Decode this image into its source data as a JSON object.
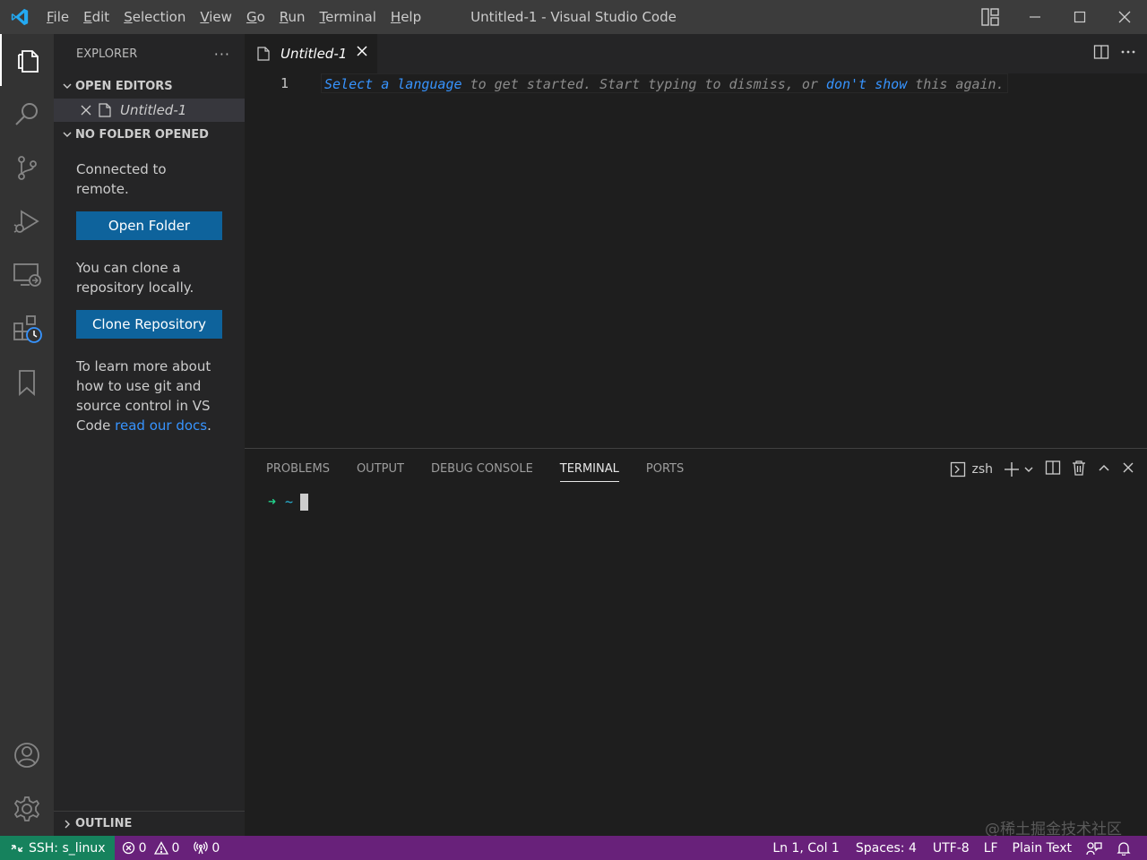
{
  "window": {
    "title": "Untitled-1 - Visual Studio Code"
  },
  "menu": [
    {
      "first": "F",
      "rest": "ile"
    },
    {
      "first": "E",
      "rest": "dit"
    },
    {
      "first": "S",
      "rest": "election"
    },
    {
      "first": "V",
      "rest": "iew"
    },
    {
      "first": "G",
      "rest": "o"
    },
    {
      "first": "R",
      "rest": "un"
    },
    {
      "first": "T",
      "rest": "erminal"
    },
    {
      "first": "H",
      "rest": "elp"
    }
  ],
  "sidebar": {
    "header": "EXPLORER",
    "more": "···",
    "open_editors_title": "OPEN EDITORS",
    "open_editor_file": "Untitled-1",
    "no_folder_title": "NO FOLDER OPENED",
    "connected_text": "Connected to remote.",
    "open_folder_label": "Open Folder",
    "clone_text": "You can clone a repository locally.",
    "clone_label": "Clone Repository",
    "learn_text": "To learn more about how to use git and source control in VS Code ",
    "learn_link": "read our docs",
    "learn_end": ".",
    "outline_title": "OUTLINE"
  },
  "editor": {
    "tab_label": "Untitled-1",
    "line_number": "1",
    "hint": {
      "select": "Select",
      "a": "a",
      "language": "language",
      "middle": "to get started. Start typing to dismiss, or",
      "dont": "don't",
      "show": "show",
      "end": "this again."
    }
  },
  "panel": {
    "tabs": [
      "PROBLEMS",
      "OUTPUT",
      "DEBUG CONSOLE",
      "TERMINAL",
      "PORTS"
    ],
    "active_tab": "TERMINAL",
    "shell": "zsh",
    "prompt_arrow": "➜",
    "prompt_dir": "~"
  },
  "statusbar": {
    "remote": "SSH: s_linux",
    "errors": "0",
    "warnings": "0",
    "ports": "0",
    "position": "Ln 1, Col 1",
    "spaces": "Spaces: 4",
    "encoding": "UTF-8",
    "eol": "LF",
    "language": "Plain Text"
  },
  "watermark": "@稀土掘金技术社区",
  "colors": {
    "titlebar": "#3c3c3c",
    "activitybar": "#333333",
    "sidebar": "#252526",
    "editor": "#1e1e1e",
    "button": "#0e639c",
    "statusbar": "#68217a",
    "remote": "#16825d",
    "link": "#3794ff"
  },
  "icons": {
    "app": "vscode-logo-icon",
    "activity": [
      "explorer-icon",
      "search-icon",
      "source-control-icon",
      "run-debug-icon",
      "remote-explorer-icon",
      "extensions-icon",
      "bookmarks-icon",
      "accounts-icon",
      "settings-gear-icon"
    ]
  }
}
